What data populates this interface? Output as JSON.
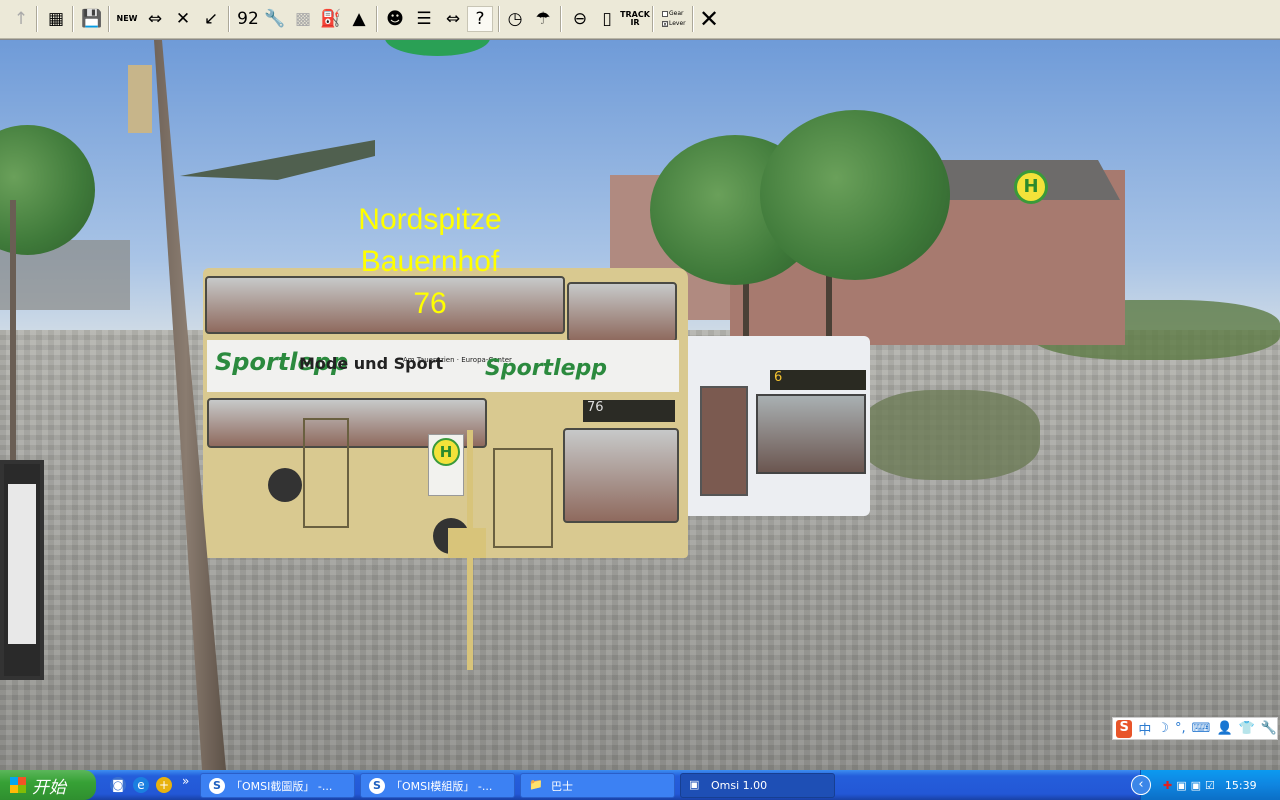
{
  "toolbar": {
    "items": [
      {
        "name": "up-arrow",
        "glyph": "↑",
        "enabled": false
      },
      {
        "name": "map",
        "glyph": "▦"
      },
      {
        "name": "save",
        "glyph": "💾"
      },
      {
        "name": "new-bus",
        "glyph": "NEW"
      },
      {
        "name": "change-bus",
        "glyph": "⇔"
      },
      {
        "name": "delete-bus",
        "glyph": "✕"
      },
      {
        "name": "pointer",
        "glyph": "↙"
      },
      {
        "name": "timetable",
        "glyph": "92"
      },
      {
        "name": "repair",
        "glyph": "🔧"
      },
      {
        "name": "ticket",
        "glyph": "▩",
        "enabled": false
      },
      {
        "name": "refuel",
        "glyph": "⛽",
        "enabled": false
      },
      {
        "name": "bell",
        "glyph": "▲"
      },
      {
        "name": "driver",
        "glyph": "☻"
      },
      {
        "name": "schedule",
        "glyph": "☰"
      },
      {
        "name": "pc-swap",
        "glyph": "⇔"
      },
      {
        "name": "help",
        "glyph": "?"
      },
      {
        "name": "clock",
        "glyph": "◷"
      },
      {
        "name": "weather",
        "glyph": "☂"
      },
      {
        "name": "steering-wheel",
        "glyph": "⊖"
      },
      {
        "name": "mouse",
        "glyph": "▯"
      },
      {
        "name": "trackir",
        "glyph": "TRACK IR"
      }
    ],
    "gear_label": "Gear",
    "lever_label": "Lever",
    "gear_checked": false,
    "lever_checked": true,
    "close_glyph": "✕"
  },
  "scene": {
    "destination_line1": "Nordspitze",
    "destination_line2": "Bauernhof",
    "route_number": "76",
    "bus_ad_brand": "Sportlepp",
    "bus_ad_slogan": "Mode und Sport",
    "bus_ad_sub": "Am Tauentzien · Europa-Center",
    "bus2_route": "6",
    "bus_stop_sign": "H"
  },
  "taskbar": {
    "start_label": "开始",
    "overflow": "»",
    "tasks": [
      {
        "label": "「OMSI截圖版」 -...",
        "icon": "S"
      },
      {
        "label": "「OMSI模組版」 -...",
        "icon": "S"
      },
      {
        "label": "巴士",
        "icon": "📁"
      },
      {
        "label": "Omsi 1.00",
        "icon": "▣",
        "active": true
      }
    ],
    "clock": "15:39"
  },
  "ime": {
    "logo": "S",
    "mode": "中",
    "items": [
      "☽",
      "°,",
      "⌨",
      "👤",
      "👕",
      "🔧"
    ]
  }
}
